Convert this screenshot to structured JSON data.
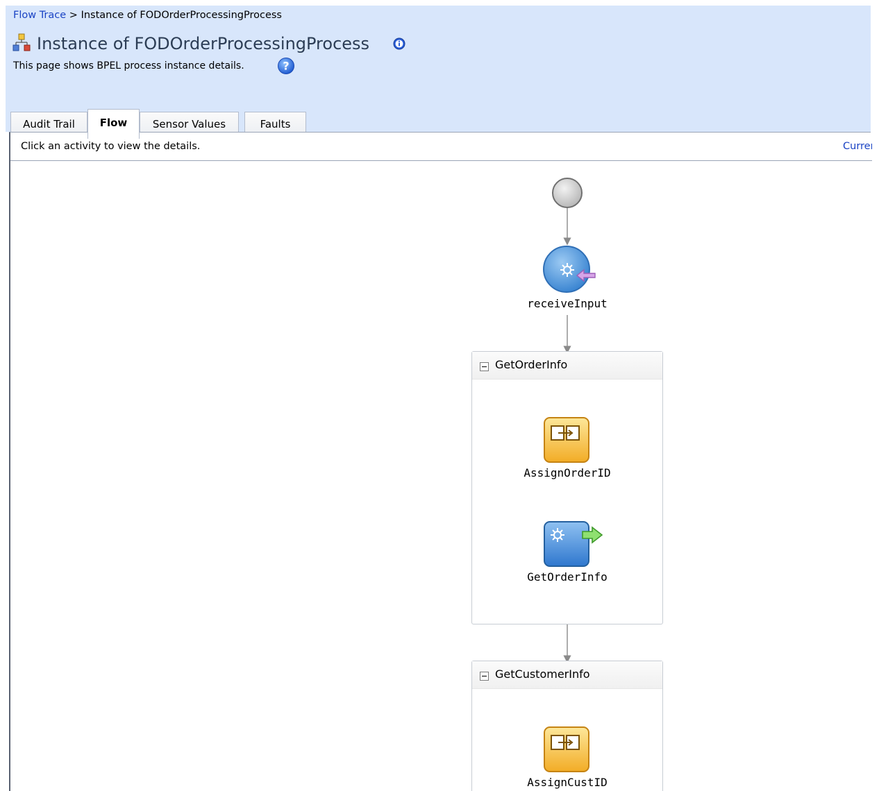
{
  "breadcrumb": {
    "root_link": "Flow Trace",
    "separator": ">",
    "current": "Instance of FODOrderProcessingProcess"
  },
  "header": {
    "title": "Instance of FODOrderProcessingProcess",
    "description": "This page shows BPEL process instance details.",
    "icons": [
      "process-instance-icon",
      "info-icon",
      "help-icon"
    ]
  },
  "tabs": [
    {
      "label": "Audit Trail",
      "active": false
    },
    {
      "label": "Flow",
      "active": true
    },
    {
      "label": "Sensor Values",
      "active": false
    },
    {
      "label": "Faults",
      "active": false
    }
  ],
  "content": {
    "instructions": "Click an activity to view the details.",
    "current_link": "Current"
  },
  "flow": {
    "start_node": "start-event",
    "receive_activity": {
      "label": "receiveInput",
      "icon": "receive-icon"
    },
    "scopes": [
      {
        "label": "GetOrderInfo",
        "activities": [
          {
            "label": "AssignOrderID",
            "icon": "assign-icon"
          },
          {
            "label": "GetOrderInfo",
            "icon": "invoke-icon"
          }
        ]
      },
      {
        "label": "GetCustomerInfo",
        "activities": [
          {
            "label": "AssignCustID",
            "icon": "assign-icon"
          }
        ]
      }
    ]
  },
  "colors": {
    "header_bg": "#d8e6fb",
    "link": "#1a43c4",
    "title": "#2c3d55",
    "receive_blue": "#4a90d6",
    "assign_orange": "#f5b632",
    "invoke_blue": "#3d86d8"
  }
}
